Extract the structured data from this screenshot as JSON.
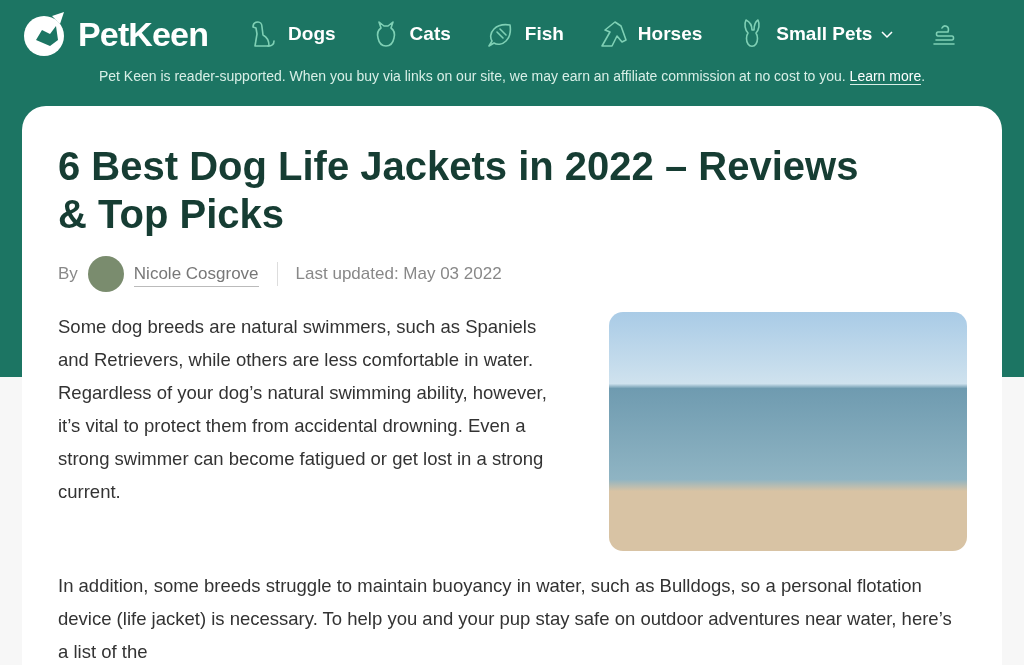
{
  "logo": {
    "text": "PetKeen"
  },
  "nav": [
    {
      "label": "Dogs",
      "kind": "dog"
    },
    {
      "label": "Cats",
      "kind": "cat"
    },
    {
      "label": "Fish",
      "kind": "fish"
    },
    {
      "label": "Horses",
      "kind": "horse"
    },
    {
      "label": "Small Pets",
      "kind": "rabbit",
      "dropdown": true
    }
  ],
  "disclosure": {
    "text": "Pet Keen is reader-supported. When you buy via links on our site, we may earn an affiliate commission at no cost to you.",
    "link": "Learn more",
    "after": "."
  },
  "article": {
    "title": "6 Best Dog Life Jackets in 2022 – Reviews & Top Picks",
    "byline": {
      "by": "By",
      "author": "Nicole Cosgrove",
      "updated": "Last updated: May 03 2022"
    },
    "paragraphs": [
      "Some dog breeds are natural swimmers, such as Spaniels and Retrievers, while others are less comfortable in water. Regardless of your dog’s natural swimming ability, however, it’s vital to protect them from accidental drowning. Even a strong swimmer can become fatigued or get lost in a strong current.",
      "In addition, some breeds struggle to maintain buoyancy in water, such as Bulldogs, so a personal flotation device (life jacket) is necessary. To help you and your pup stay safe on outdoor adventures near water, here’s a list of the"
    ]
  }
}
